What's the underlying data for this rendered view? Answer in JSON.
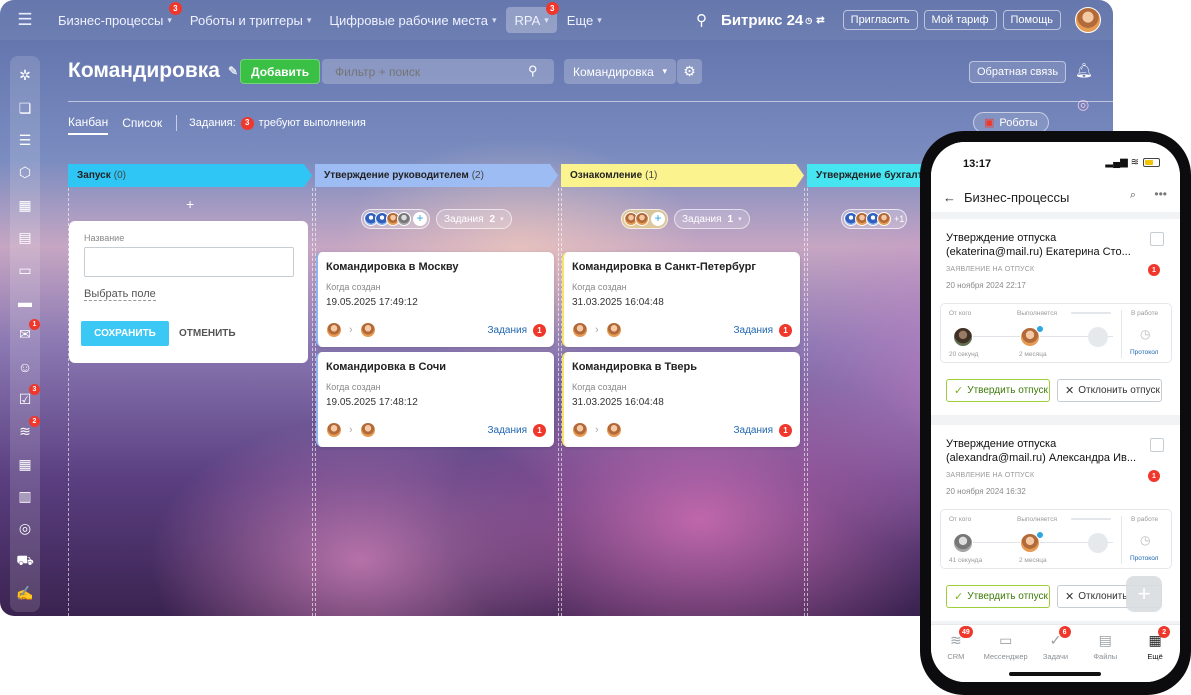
{
  "topbar": {
    "nav": [
      {
        "label": "Бизнес-процессы",
        "badge": "3",
        "active": false,
        "chevron": true
      },
      {
        "label": "Роботы и триггеры",
        "badge": "",
        "active": false,
        "chevron": true
      },
      {
        "label": "Цифровые рабочие места",
        "badge": "",
        "active": false,
        "chevron": true
      },
      {
        "label": "RPA",
        "badge": "3",
        "active": true,
        "chevron": true
      },
      {
        "label": "Еще",
        "badge": "",
        "active": false,
        "chevron": true
      }
    ],
    "brand": "Битрикс 24",
    "invite": "Пригласить",
    "tariff": "Мой тариф",
    "help": "Помощь"
  },
  "sidebar": {
    "items": [
      {
        "icon": "puzzle-icon",
        "glyph": "✲",
        "badge": ""
      },
      {
        "icon": "chat-icon",
        "glyph": "❏",
        "badge": ""
      },
      {
        "icon": "feed-icon",
        "glyph": "☰",
        "badge": ""
      },
      {
        "icon": "hexagon-icon",
        "glyph": "⬡",
        "badge": ""
      },
      {
        "icon": "calendar-icon",
        "glyph": "▦",
        "badge": ""
      },
      {
        "icon": "document-icon",
        "glyph": "▤",
        "badge": ""
      },
      {
        "icon": "presentation-icon",
        "glyph": "▭",
        "badge": ""
      },
      {
        "icon": "drive-icon",
        "glyph": "▬",
        "badge": ""
      },
      {
        "icon": "mail-icon",
        "glyph": "✉",
        "badge": "1"
      },
      {
        "icon": "contacts-icon",
        "glyph": "☺",
        "badge": ""
      },
      {
        "icon": "tasks-icon",
        "glyph": "☑",
        "badge": "3"
      },
      {
        "icon": "funnel-icon",
        "glyph": "≋",
        "badge": "2"
      },
      {
        "icon": "planner-icon",
        "glyph": "▦",
        "badge": ""
      },
      {
        "icon": "store-icon",
        "glyph": "▥",
        "badge": ""
      },
      {
        "icon": "target-icon",
        "glyph": "◎",
        "badge": ""
      },
      {
        "icon": "cart-icon",
        "glyph": "⛟",
        "badge": ""
      },
      {
        "icon": "sign-document-icon",
        "glyph": "✍",
        "badge": ""
      }
    ]
  },
  "toolbar": {
    "title": "Командировка",
    "add": "Добавить",
    "filter_placeholder": "Фильтр + поиск",
    "select": "Командировка",
    "feedback": "Обратная связь"
  },
  "views": {
    "kanban": "Канбан",
    "list": "Список",
    "tasks_prefix": "Задания:",
    "tasks_count": "3",
    "tasks_suffix": "требуют выполнения",
    "robots": "Роботы"
  },
  "columns": [
    {
      "title": "Запуск",
      "count": "(0)",
      "color": "#2fc6f6"
    },
    {
      "title": "Утверждение руководителем",
      "count": "(2)",
      "color": "#9dbcf4"
    },
    {
      "title": "Ознакомление",
      "count": "(1)",
      "color": "#fbf48e"
    },
    {
      "title": "Утверждение бухгалт",
      "count": "",
      "color": "#47e4f2"
    }
  ],
  "quickform": {
    "label": "Название",
    "choose_field": "Выбрать поле",
    "save": "СОХРАНИТЬ",
    "cancel": "ОТМЕНИТЬ"
  },
  "column_tools": [
    {
      "tasks_label": "Задания",
      "tasks_count": "2"
    },
    {
      "tasks_label": "Задания",
      "tasks_count": "1"
    },
    {
      "extra": "+1"
    }
  ],
  "cards": [
    {
      "title": "Командировка в Москву",
      "label": "Когда создан",
      "date": "19.05.2025 17:49:12",
      "tasks": "Задания",
      "badge": "1"
    },
    {
      "title": "Командировка в Сочи",
      "label": "Когда создан",
      "date": "19.05.2025 17:48:12",
      "tasks": "Задания",
      "badge": "1"
    },
    {
      "title": "Командировка в Санкт-Петербург",
      "label": "Когда создан",
      "date": "31.03.2025 16:04:48",
      "tasks": "Задания",
      "badge": "1"
    },
    {
      "title": "Командировка в Тверь",
      "label": "Когда создан",
      "date": "31.03.2025 16:04:48",
      "tasks": "Задания",
      "badge": "1"
    }
  ],
  "phone": {
    "time": "13:17",
    "header": "Бизнес-процессы",
    "items": [
      {
        "title": "Утверждение отпуска (ekaterina@mail.ru) Екатерина Сто...",
        "type": "ЗАЯВЛЕНИЕ НА ОТПУСК",
        "badge": "1",
        "date": "20 ноября 2024 22:17",
        "from": "От кого",
        "executing": "Выполняется",
        "at_work": "В работе",
        "from_time": "20 секунд",
        "exec_time": "2 месяца",
        "protocol": "Протокол",
        "approve": "Утвердить отпуск",
        "reject": "Отклонить отпуск"
      },
      {
        "title": "Утверждение отпуска (alexandra@mail.ru) Александра Ив...",
        "type": "ЗАЯВЛЕНИЕ НА ОТПУСК",
        "badge": "1",
        "date": "20 ноября 2024 16:32",
        "from": "От кого",
        "executing": "Выполняется",
        "at_work": "В работе",
        "from_time": "41 секунда",
        "exec_time": "2 месяца",
        "protocol": "Протокол",
        "approve": "Утвердить отпуск",
        "reject": "Отклонить"
      }
    ],
    "tabs": [
      {
        "label": "CRM",
        "icon": "crm-funnel-icon",
        "glyph": "≋",
        "badge": "49",
        "active": false
      },
      {
        "label": "Мессенджер",
        "icon": "messenger-icon",
        "glyph": "▭",
        "badge": "",
        "active": false
      },
      {
        "label": "Задачи",
        "icon": "tasks-check-icon",
        "glyph": "✓",
        "badge": "6",
        "active": false
      },
      {
        "label": "Файлы",
        "icon": "files-icon",
        "glyph": "▤",
        "badge": "",
        "active": false
      },
      {
        "label": "Ещё",
        "icon": "more-grid-icon",
        "glyph": "▦",
        "badge": "2",
        "active": true
      }
    ]
  }
}
